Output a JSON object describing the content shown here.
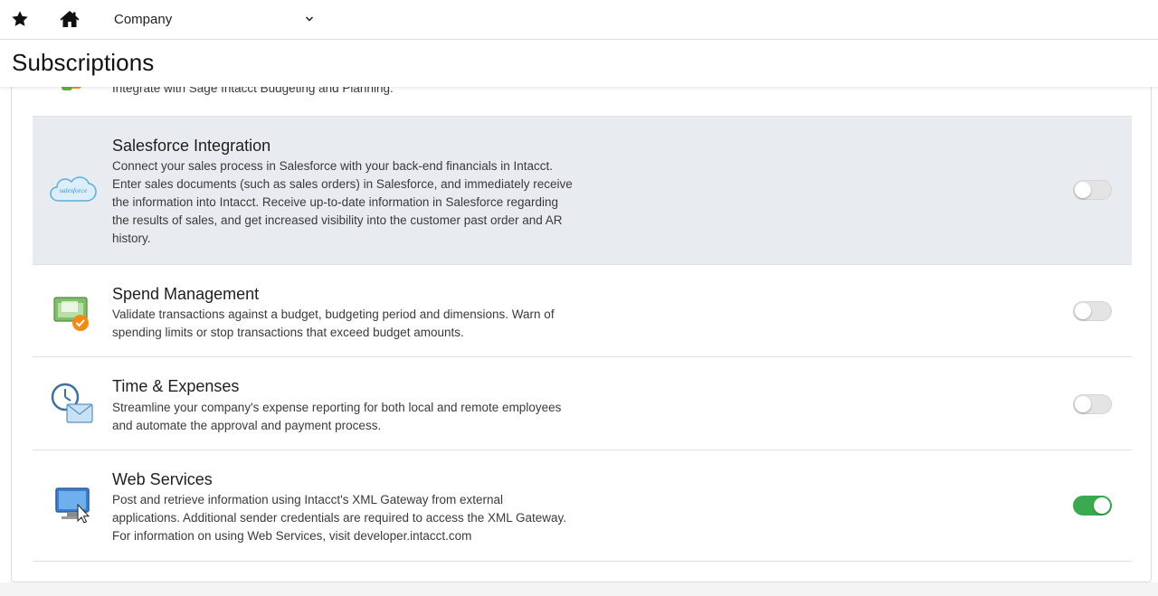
{
  "header": {
    "company_label": "Company",
    "star_icon": "star-icon",
    "home_icon": "home-icon"
  },
  "page": {
    "title": "Subscriptions"
  },
  "colors": {
    "toggle_on": "#3aa94f",
    "highlight_row": "#e8ebef"
  },
  "rows": [
    {
      "title": "",
      "description": "Integrate with Sage Intacct Budgeting and Planning.",
      "icon": "budgeting-planning-icon",
      "enabled": false
    },
    {
      "title": "Salesforce Integration",
      "description": "Connect your sales process in Salesforce with your back-end financials in Intacct. Enter sales documents (such as sales orders) in Salesforce, and immediately receive the information into Intacct. Receive up-to-date information in Salesforce regarding the results of sales, and get increased visibility into the customer past order and AR history.",
      "icon": "salesforce-icon",
      "icon_text": "salesforce",
      "enabled": false
    },
    {
      "title": "Spend Management",
      "description": "Validate transactions against a budget, budgeting period and dimensions. Warn of spending limits or stop transactions that exceed budget amounts.",
      "icon": "spend-management-icon",
      "enabled": false
    },
    {
      "title": "Time & Expenses",
      "description": "Streamline your company's expense reporting for both local and remote employees and automate the approval and payment process.",
      "icon": "time-expenses-icon",
      "enabled": false
    },
    {
      "title": "Web Services",
      "description": "Post and retrieve information using Intacct's XML Gateway from external applications. Additional sender credentials are required to access the XML Gateway. For information on using Web Services, visit developer.intacct.com",
      "icon": "web-services-icon",
      "enabled": true
    }
  ]
}
